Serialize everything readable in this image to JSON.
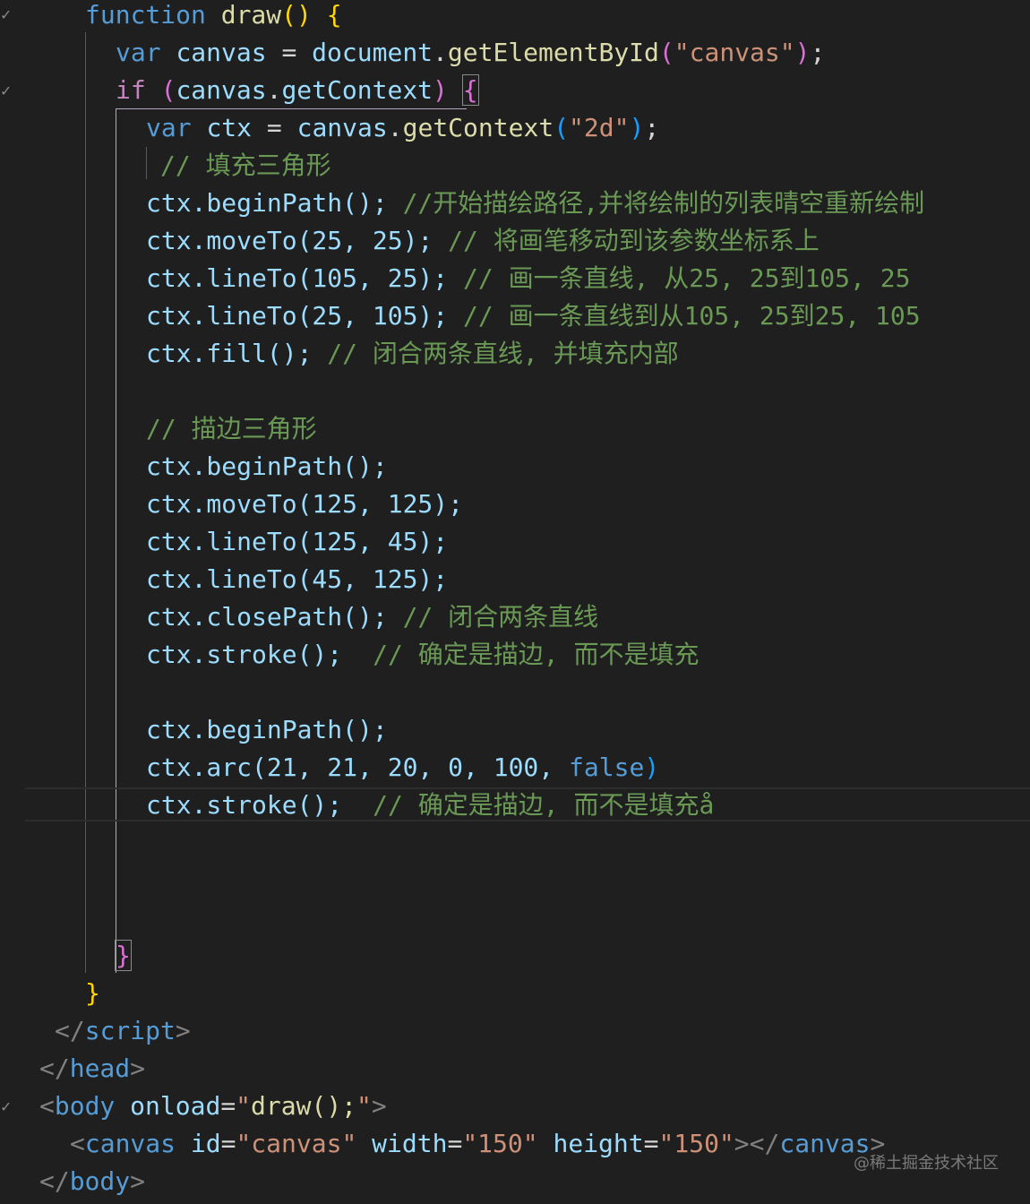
{
  "gutter_marks": [
    "✓",
    "✓",
    "✓"
  ],
  "lines": {
    "l1_kw": "function",
    "l1_fn": "draw",
    "l1_paren": "()",
    "l1_brace": "{",
    "l2_kw": "var",
    "l2_var": "canvas",
    "l2_eq": "=",
    "l2_obj": "document",
    "l2_dot": ".",
    "l2_fn": "getElementById",
    "l2_po": "(",
    "l2_str": "\"canvas\"",
    "l2_pc": ")",
    "l2_semi": ";",
    "l3_kw": "if",
    "l3_po": "(",
    "l3_obj": "canvas",
    "l3_dot": ".",
    "l3_prop": "getContext",
    "l3_pc": ")",
    "l3_brace": "{",
    "l4_kw": "var",
    "l4_var": "ctx",
    "l4_eq": "=",
    "l4_obj": "canvas",
    "l4_dot": ".",
    "l4_fn": "getContext",
    "l4_po": "(",
    "l4_str": "\"2d\"",
    "l4_pc": ")",
    "l4_semi": ";",
    "l5_cmt": "// 填充三角形",
    "l6_code": "ctx.beginPath();",
    "l6_cmt": "//开始描绘路径,并将绘制的列表晴空重新绘制",
    "l7_code": "ctx.moveTo(25, 25);",
    "l7_cmt": "// 将画笔移动到该参数坐标系上",
    "l8_code": "ctx.lineTo(105, 25);",
    "l8_cmt": "// 画一条直线, 从25, 25到105, 25",
    "l9_code": "ctx.lineTo(25, 105);",
    "l9_cmt": "// 画一条直线到从105, 25到25, 105",
    "l10_code": "ctx.fill();",
    "l10_cmt": "// 闭合两条直线, 并填充内部",
    "l12_cmt": "// 描边三角形",
    "l13_code": "ctx.beginPath();",
    "l14_code": "ctx.moveTo(125, 125);",
    "l15_code": "ctx.lineTo(125, 45);",
    "l16_code": "ctx.lineTo(45, 125);",
    "l17_code": "ctx.closePath();",
    "l17_cmt": "// 闭合两条直线",
    "l18_code": "ctx.stroke();",
    "l18_cmt": "// 确定是描边, 而不是填充",
    "l20_code": "ctx.beginPath();",
    "l21_code": "ctx.arc(21, 21, 20, 0, 100, ",
    "l21_bool": "false",
    "l21_end": ")",
    "l22_code": "ctx.stroke();",
    "l22_cmt": "// 确定是描边, 而不是填充å",
    "l26_brace": "}",
    "l27_brace": "}",
    "l28_open": "</",
    "l28_tag": "script",
    "l28_close": ">",
    "l29_open": "</",
    "l29_tag": "head",
    "l29_close": ">",
    "l30_open": "<",
    "l30_tag": "body",
    "l30_attr": "onload",
    "l30_eq": "=",
    "l30_q1": "\"",
    "l30_val": "draw();",
    "l30_q2": "\"",
    "l30_close": ">",
    "l31_open": "<",
    "l31_tag": "canvas",
    "l31_a1": "id",
    "l31_v1": "\"canvas\"",
    "l31_a2": "width",
    "l31_v2": "\"150\"",
    "l31_a3": "height",
    "l31_v3": "\"150\"",
    "l31_mid": "></",
    "l31_tag2": "canvas",
    "l31_close": ">",
    "l32_open": "</",
    "l32_tag": "body",
    "l32_close": ">",
    "eq_sign": "=",
    "space": " "
  },
  "watermark": "@稀土掘金技术社区"
}
